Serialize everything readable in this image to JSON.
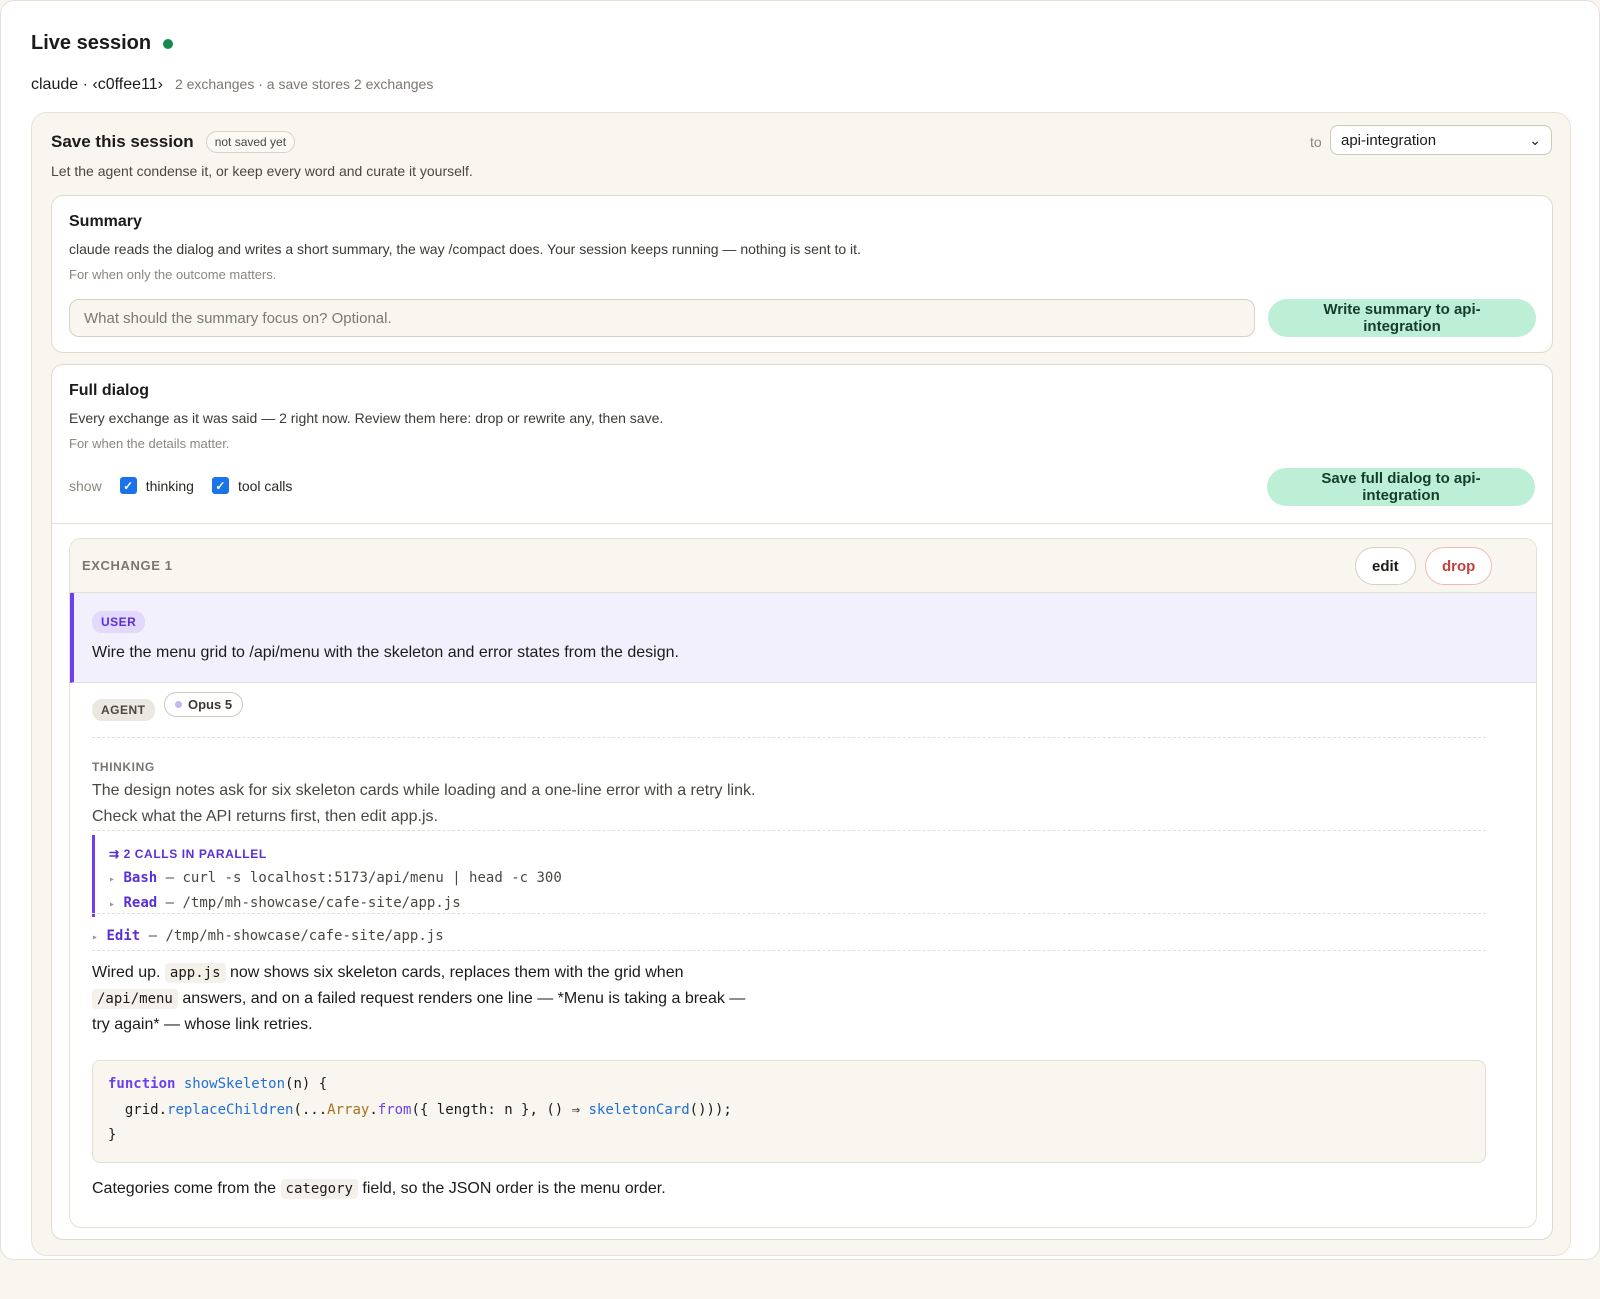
{
  "session": {
    "title": "Live session",
    "agent_label": "claude · ‹c0ffee11›",
    "info": "2 exchanges · a save stores 2 exchanges"
  },
  "save": {
    "title": "Save this session",
    "status": "not saved yet",
    "description": "Let the agent condense it, or keep every word and curate it yourself.",
    "to_label": "to",
    "destination": "api-integration"
  },
  "summary": {
    "heading": "Summary",
    "description": "claude reads the dialog and writes a short summary, the way /compact does. Your session keeps running — nothing is sent to it.",
    "hint": "For when only the outcome matters.",
    "focus_placeholder": "What should the summary focus on? Optional.",
    "button_label": "Write summary to api-integration"
  },
  "full_dialog": {
    "heading": "Full dialog",
    "description": "Every exchange as it was said — 2 right now. Review them here: drop or rewrite any, then save.",
    "hint": "For when the details matter.",
    "show_label": "show",
    "filters": [
      {
        "label": "thinking",
        "checked": true
      },
      {
        "label": "tool calls",
        "checked": true
      }
    ],
    "button_label": "Save full dialog to api-integration"
  },
  "exchange": {
    "label": "EXCHANGE 1",
    "edit_label": "edit",
    "drop_label": "drop",
    "user": {
      "role": "USER",
      "text": "Wire the menu grid to /api/menu with the skeleton and error states from the design."
    },
    "agent": {
      "role": "AGENT",
      "model": "Opus 5",
      "thinking_label": "THINKING",
      "thinking_lines": [
        "The design notes ask for six skeleton cards while loading and a one-line error with a retry link.",
        "Check what the API returns first, then edit app.js."
      ],
      "parallel_label": "⇉ 2 CALLS IN PARALLEL",
      "parallel_calls": [
        {
          "tool": "Bash",
          "args": "curl -s localhost:5173/api/menu | head -c 300"
        },
        {
          "tool": "Read",
          "args": "/tmp/mh-showcase/cafe-site/app.js"
        }
      ],
      "single_call": {
        "tool": "Edit",
        "args": "/tmp/mh-showcase/cafe-site/app.js"
      },
      "reply": {
        "l1_a": "Wired up.",
        "l1_code": "app.js",
        "l1_b": "now shows six skeleton cards, replaces them with the grid when",
        "l2_code": "/api/menu",
        "l2_b": "answers, and on a failed request renders one line — *Menu is taking a break —",
        "l3": "try again* — whose link retries."
      },
      "code": {
        "l1_kw": "function",
        "l1_fn": "showSkeleton",
        "l1_rest": "(n) {",
        "l2_a": "  grid.",
        "l2_fn": "replaceChildren",
        "l2_b": "(...",
        "l2_ty": "Array",
        "l2_c": ".",
        "l2_from": "from",
        "l2_d": "({ length: n }, () ⇒ ",
        "l2_fn2": "skeletonCard",
        "l2_e": "()));",
        "l3": "}"
      },
      "closing": {
        "a": "Categories come from the",
        "code": "category",
        "b": "field, so the JSON order is the menu order."
      }
    }
  },
  "colors": {
    "accent_purple": "#6d3ff0",
    "live_green": "#168a4e",
    "button_green": "#bcefd5",
    "drop_red": "#c6403b"
  },
  "icons": {
    "live": "green-dot",
    "select": "chevron-down-icon",
    "checkbox": "check-icon",
    "model": "purple-dot",
    "expand": "triangle-right-icon"
  }
}
